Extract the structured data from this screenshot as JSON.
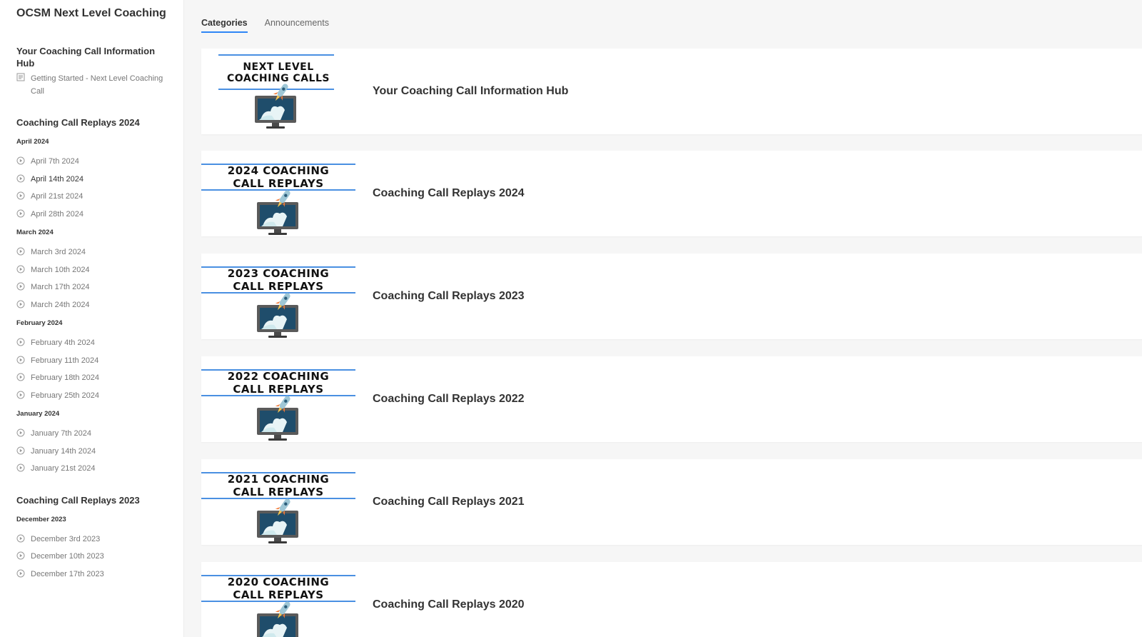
{
  "brand": "OCSM Next Level Coaching",
  "sidebar": {
    "hub": {
      "title": "Your Coaching Call Information Hub",
      "lessons": [
        {
          "label": "Getting Started - Next Level Coaching Call",
          "icon": "document-icon"
        }
      ]
    },
    "replays_2024": {
      "title": "Coaching Call Replays 2024",
      "months": [
        {
          "name": "April 2024",
          "lessons": [
            "April 7th 2024",
            "April 14th 2024",
            "April 21st 2024",
            "April 28th 2024"
          ]
        },
        {
          "name": "March 2024",
          "lessons": [
            "March 3rd 2024",
            "March 10th 2024",
            "March 17th 2024",
            "March 24th 2024"
          ]
        },
        {
          "name": "February 2024",
          "lessons": [
            "February 4th 2024",
            "February 11th 2024",
            "February 18th 2024",
            "February 25th 2024"
          ]
        },
        {
          "name": "January 2024",
          "lessons": [
            "January 7th 2024",
            "January 14th 2024",
            "January 21st 2024"
          ]
        }
      ]
    },
    "replays_2023": {
      "title": "Coaching Call Replays 2023",
      "months": [
        {
          "name": "December 2023",
          "lessons": [
            "December 3rd 2023",
            "December 10th 2023",
            "December 17th 2023"
          ]
        }
      ]
    }
  },
  "tabs": [
    {
      "label": "Categories",
      "active": true
    },
    {
      "label": "Announcements",
      "active": false
    }
  ],
  "categories": [
    {
      "title": "Your Coaching Call Information Hub",
      "thumb_line1": "NEXT LEVEL",
      "thumb_line2": "COACHING CALLS"
    },
    {
      "title": "Coaching Call Replays 2024",
      "thumb_line1": "2024 COACHING",
      "thumb_line2": "CALL REPLAYS"
    },
    {
      "title": "Coaching Call Replays 2023",
      "thumb_line1": "2023 COACHING",
      "thumb_line2": "CALL REPLAYS"
    },
    {
      "title": "Coaching Call Replays 2022",
      "thumb_line1": "2022 COACHING",
      "thumb_line2": "CALL REPLAYS"
    },
    {
      "title": "Coaching Call Replays 2021",
      "thumb_line1": "2021 COACHING",
      "thumb_line2": "CALL REPLAYS"
    },
    {
      "title": "Coaching Call Replays 2020",
      "thumb_line1": "2020 COACHING",
      "thumb_line2": "CALL REPLAYS"
    }
  ],
  "colors": {
    "accent": "#2f86f6",
    "thumb_line": "#4a90e2"
  },
  "icons": {
    "lesson": "play-circle-icon",
    "document": "document-icon",
    "thumb_art": "rocket-monitor-icon"
  }
}
